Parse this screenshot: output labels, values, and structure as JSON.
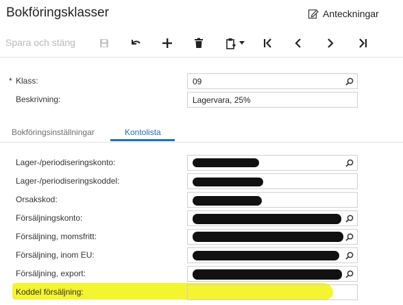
{
  "header": {
    "title": "Bokföringsklasser",
    "notes_label": "Anteckningar"
  },
  "toolbar": {
    "save_close_label": "Spara och stäng",
    "icons": [
      "save-icon",
      "undo-icon",
      "add-icon",
      "delete-icon",
      "clipboard-icon",
      "chevron-down-icon",
      "first-icon",
      "previous-icon",
      "next-icon",
      "last-icon"
    ]
  },
  "form": {
    "klass": {
      "label": "Klass:",
      "required_mark": "*",
      "value": "09"
    },
    "beskrivning": {
      "label": "Beskrivning:",
      "value": "Lagervara, 25%"
    }
  },
  "tabs": [
    {
      "label": "Bokföringsinställningar",
      "active": false
    },
    {
      "label": "Kontolista",
      "active": true
    }
  ],
  "accounts": [
    {
      "label": "Lager-/periodiseringskonto:",
      "value": "",
      "redacted": true
    },
    {
      "label": "Lager-/periodiseringskoddel:",
      "value": "",
      "redacted": true
    },
    {
      "label": "Orsakskod:",
      "value": "",
      "redacted": true
    },
    {
      "label": "Försäljningskonto:",
      "value": "",
      "redacted": true
    },
    {
      "label": "Försäljning, momsfritt:",
      "value": "",
      "redacted": true
    },
    {
      "label": "Försäljning, inom EU:",
      "value": "",
      "redacted": true
    },
    {
      "label": "Försäljning, export:",
      "value": "",
      "redacted": true
    },
    {
      "label": "Koddel försäljning:",
      "value": "",
      "redacted": false,
      "highlighted": true
    }
  ],
  "colors": {
    "accent": "#1d6fb4",
    "highlight": "#f2f20a",
    "redaction": "#111111"
  }
}
